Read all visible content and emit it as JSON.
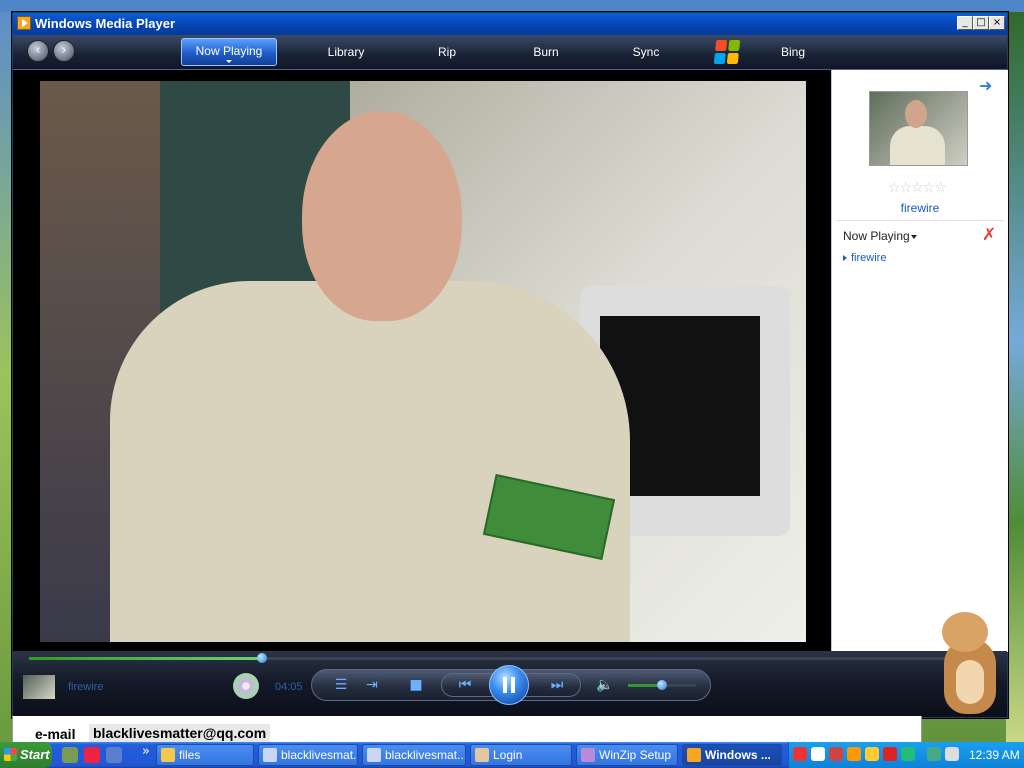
{
  "window": {
    "title": "Windows Media Player",
    "controls": {
      "minimize": "_",
      "maximize": "□",
      "close": "×"
    }
  },
  "nav": {
    "back_icon": "back-arrow-icon",
    "forward_icon": "forward-arrow-icon",
    "tabs": [
      {
        "label": "Now Playing",
        "active": true
      },
      {
        "label": "Library"
      },
      {
        "label": "Rip"
      },
      {
        "label": "Burn"
      },
      {
        "label": "Sync"
      },
      {
        "label": "Bing"
      }
    ],
    "logo_colors": [
      "#f25022",
      "#7fba00",
      "#00a4ef",
      "#ffb900"
    ]
  },
  "sidepanel": {
    "arrow": "➜",
    "rating": "☆☆☆☆☆",
    "title": "firewire",
    "playlist_label": "Now Playing",
    "clear_icon": "✗",
    "playlist": [
      "firewire"
    ]
  },
  "player": {
    "seek_progress": 0.25,
    "track_name": "firewire",
    "elapsed": "04:05",
    "volume": 0.5,
    "accent_color": "#3b8ff0"
  },
  "background_window": {
    "email_label": "e-mail",
    "email_value": "blacklivesmatter@qq.com"
  },
  "taskbar": {
    "start": "Start",
    "chevron": "»",
    "tasks": [
      {
        "label": "files",
        "icon_color": "#f2c94c"
      },
      {
        "label": "blacklivesmat...",
        "icon_color": "#c9d7f0"
      },
      {
        "label": "blacklivesmat...",
        "icon_color": "#c9d7f0"
      },
      {
        "label": "Login",
        "icon_color": "#e0c7a0"
      },
      {
        "label": "WinZip Setup",
        "icon_color": "#b78bd6"
      },
      {
        "label": "Windows ...",
        "icon_color": "#f5a623",
        "active": true
      }
    ],
    "clock": "12:39 AM"
  }
}
